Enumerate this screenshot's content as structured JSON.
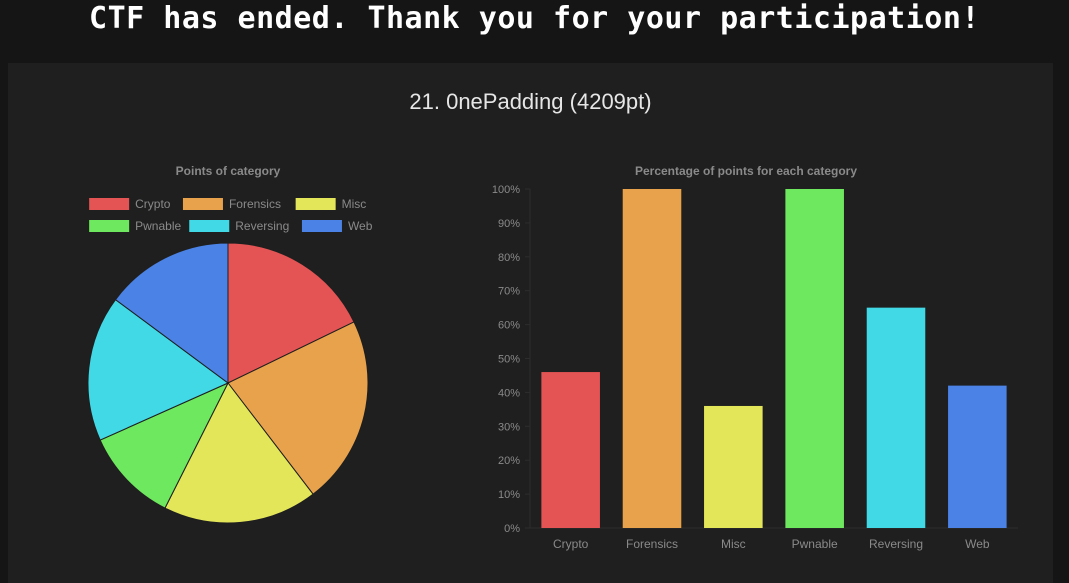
{
  "banner": {
    "message": "CTF has ended. Thank you for your participation!"
  },
  "team": {
    "heading": "21. 0nePadding (4209pt)"
  },
  "chart_data": [
    {
      "type": "pie",
      "title": "Points of category",
      "legend_position": "top",
      "categories": [
        "Crypto",
        "Forensics",
        "Misc",
        "Pwnable",
        "Reversing",
        "Web"
      ],
      "values": [
        18,
        22,
        18,
        11,
        17,
        15
      ],
      "colors": [
        "#e45454",
        "#e8a24c",
        "#e4e65a",
        "#6ee85e",
        "#42d9e6",
        "#4a82e6"
      ]
    },
    {
      "type": "bar",
      "title": "Percentage of points for each category",
      "categories": [
        "Crypto",
        "Forensics",
        "Misc",
        "Pwnable",
        "Reversing",
        "Web"
      ],
      "values": [
        46,
        100,
        36,
        100,
        65,
        42
      ],
      "colors": [
        "#e45454",
        "#e8a24c",
        "#e4e65a",
        "#6ee85e",
        "#42d9e6",
        "#4a82e6"
      ],
      "ylim": [
        0,
        100
      ],
      "yticks": [
        "0%",
        "10%",
        "20%",
        "30%",
        "40%",
        "50%",
        "60%",
        "70%",
        "80%",
        "90%",
        "100%"
      ],
      "grid": false,
      "legend": false
    }
  ]
}
